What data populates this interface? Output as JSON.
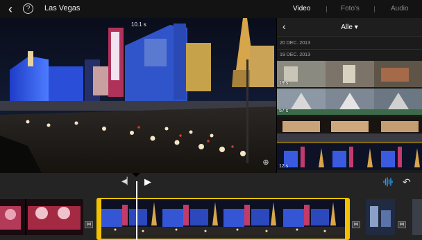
{
  "topbar": {
    "back_label": "‹",
    "help_label": "?",
    "title": "Las Vegas",
    "tabs": [
      {
        "label": "Video",
        "active": true
      },
      {
        "label": "Foto's",
        "active": false
      },
      {
        "label": "Audio",
        "active": false
      }
    ]
  },
  "viewer": {
    "duration": "10.1 s",
    "zoom_icon": "zoom-icon"
  },
  "browser": {
    "back_label": "‹",
    "filter_label": "Alle",
    "dates": [
      "20 DEC. 2013",
      "19 DEC. 2013"
    ],
    "rows": [
      {
        "duration": "19 s",
        "selected": false
      },
      {
        "duration": "57 s",
        "selected": false
      },
      {
        "duration": "",
        "selected": true
      },
      {
        "duration": "12 s",
        "selected": false
      }
    ]
  },
  "timeline": {
    "prev_icon": "skip-back-icon",
    "play_icon": "play-icon",
    "audio_icon": "waveform-icon",
    "undo_icon": "undo-icon",
    "transition_icon": "transition-icon",
    "colors": {
      "selection": "#f2c200",
      "accent": "#2e9bf0"
    }
  }
}
